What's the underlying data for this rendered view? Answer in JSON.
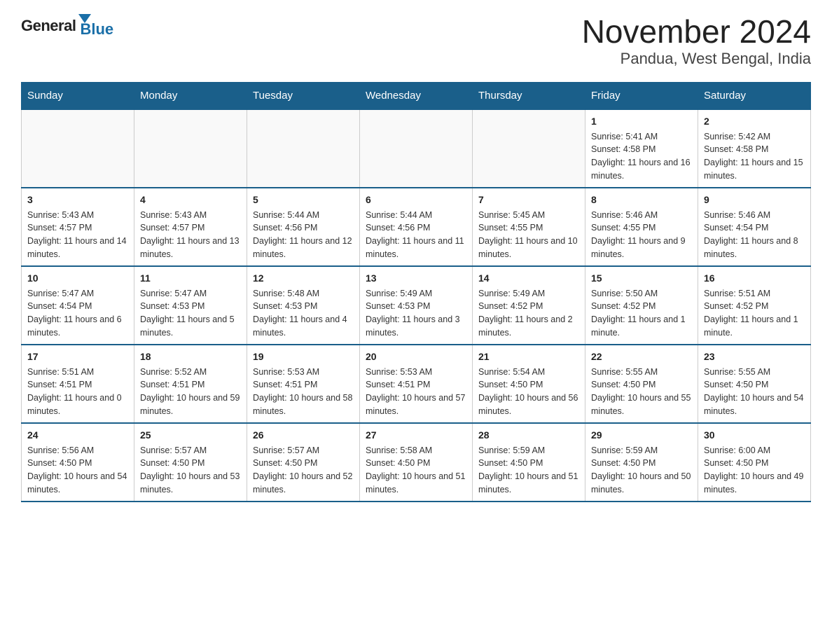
{
  "header": {
    "logo": {
      "general": "General",
      "blue": "Blue",
      "subtitle": "Blue"
    },
    "title": "November 2024",
    "location": "Pandua, West Bengal, India"
  },
  "days_of_week": [
    "Sunday",
    "Monday",
    "Tuesday",
    "Wednesday",
    "Thursday",
    "Friday",
    "Saturday"
  ],
  "weeks": [
    {
      "days": [
        {
          "num": "",
          "empty": true
        },
        {
          "num": "",
          "empty": true
        },
        {
          "num": "",
          "empty": true
        },
        {
          "num": "",
          "empty": true
        },
        {
          "num": "",
          "empty": true
        },
        {
          "num": "1",
          "sunrise": "5:41 AM",
          "sunset": "4:58 PM",
          "daylight": "11 hours and 16 minutes."
        },
        {
          "num": "2",
          "sunrise": "5:42 AM",
          "sunset": "4:58 PM",
          "daylight": "11 hours and 15 minutes."
        }
      ]
    },
    {
      "days": [
        {
          "num": "3",
          "sunrise": "5:43 AM",
          "sunset": "4:57 PM",
          "daylight": "11 hours and 14 minutes."
        },
        {
          "num": "4",
          "sunrise": "5:43 AM",
          "sunset": "4:57 PM",
          "daylight": "11 hours and 13 minutes."
        },
        {
          "num": "5",
          "sunrise": "5:44 AM",
          "sunset": "4:56 PM",
          "daylight": "11 hours and 12 minutes."
        },
        {
          "num": "6",
          "sunrise": "5:44 AM",
          "sunset": "4:56 PM",
          "daylight": "11 hours and 11 minutes."
        },
        {
          "num": "7",
          "sunrise": "5:45 AM",
          "sunset": "4:55 PM",
          "daylight": "11 hours and 10 minutes."
        },
        {
          "num": "8",
          "sunrise": "5:46 AM",
          "sunset": "4:55 PM",
          "daylight": "11 hours and 9 minutes."
        },
        {
          "num": "9",
          "sunrise": "5:46 AM",
          "sunset": "4:54 PM",
          "daylight": "11 hours and 8 minutes."
        }
      ]
    },
    {
      "days": [
        {
          "num": "10",
          "sunrise": "5:47 AM",
          "sunset": "4:54 PM",
          "daylight": "11 hours and 6 minutes."
        },
        {
          "num": "11",
          "sunrise": "5:47 AM",
          "sunset": "4:53 PM",
          "daylight": "11 hours and 5 minutes."
        },
        {
          "num": "12",
          "sunrise": "5:48 AM",
          "sunset": "4:53 PM",
          "daylight": "11 hours and 4 minutes."
        },
        {
          "num": "13",
          "sunrise": "5:49 AM",
          "sunset": "4:53 PM",
          "daylight": "11 hours and 3 minutes."
        },
        {
          "num": "14",
          "sunrise": "5:49 AM",
          "sunset": "4:52 PM",
          "daylight": "11 hours and 2 minutes."
        },
        {
          "num": "15",
          "sunrise": "5:50 AM",
          "sunset": "4:52 PM",
          "daylight": "11 hours and 1 minute."
        },
        {
          "num": "16",
          "sunrise": "5:51 AM",
          "sunset": "4:52 PM",
          "daylight": "11 hours and 1 minute."
        }
      ]
    },
    {
      "days": [
        {
          "num": "17",
          "sunrise": "5:51 AM",
          "sunset": "4:51 PM",
          "daylight": "11 hours and 0 minutes."
        },
        {
          "num": "18",
          "sunrise": "5:52 AM",
          "sunset": "4:51 PM",
          "daylight": "10 hours and 59 minutes."
        },
        {
          "num": "19",
          "sunrise": "5:53 AM",
          "sunset": "4:51 PM",
          "daylight": "10 hours and 58 minutes."
        },
        {
          "num": "20",
          "sunrise": "5:53 AM",
          "sunset": "4:51 PM",
          "daylight": "10 hours and 57 minutes."
        },
        {
          "num": "21",
          "sunrise": "5:54 AM",
          "sunset": "4:50 PM",
          "daylight": "10 hours and 56 minutes."
        },
        {
          "num": "22",
          "sunrise": "5:55 AM",
          "sunset": "4:50 PM",
          "daylight": "10 hours and 55 minutes."
        },
        {
          "num": "23",
          "sunrise": "5:55 AM",
          "sunset": "4:50 PM",
          "daylight": "10 hours and 54 minutes."
        }
      ]
    },
    {
      "days": [
        {
          "num": "24",
          "sunrise": "5:56 AM",
          "sunset": "4:50 PM",
          "daylight": "10 hours and 54 minutes."
        },
        {
          "num": "25",
          "sunrise": "5:57 AM",
          "sunset": "4:50 PM",
          "daylight": "10 hours and 53 minutes."
        },
        {
          "num": "26",
          "sunrise": "5:57 AM",
          "sunset": "4:50 PM",
          "daylight": "10 hours and 52 minutes."
        },
        {
          "num": "27",
          "sunrise": "5:58 AM",
          "sunset": "4:50 PM",
          "daylight": "10 hours and 51 minutes."
        },
        {
          "num": "28",
          "sunrise": "5:59 AM",
          "sunset": "4:50 PM",
          "daylight": "10 hours and 51 minutes."
        },
        {
          "num": "29",
          "sunrise": "5:59 AM",
          "sunset": "4:50 PM",
          "daylight": "10 hours and 50 minutes."
        },
        {
          "num": "30",
          "sunrise": "6:00 AM",
          "sunset": "4:50 PM",
          "daylight": "10 hours and 49 minutes."
        }
      ]
    }
  ]
}
